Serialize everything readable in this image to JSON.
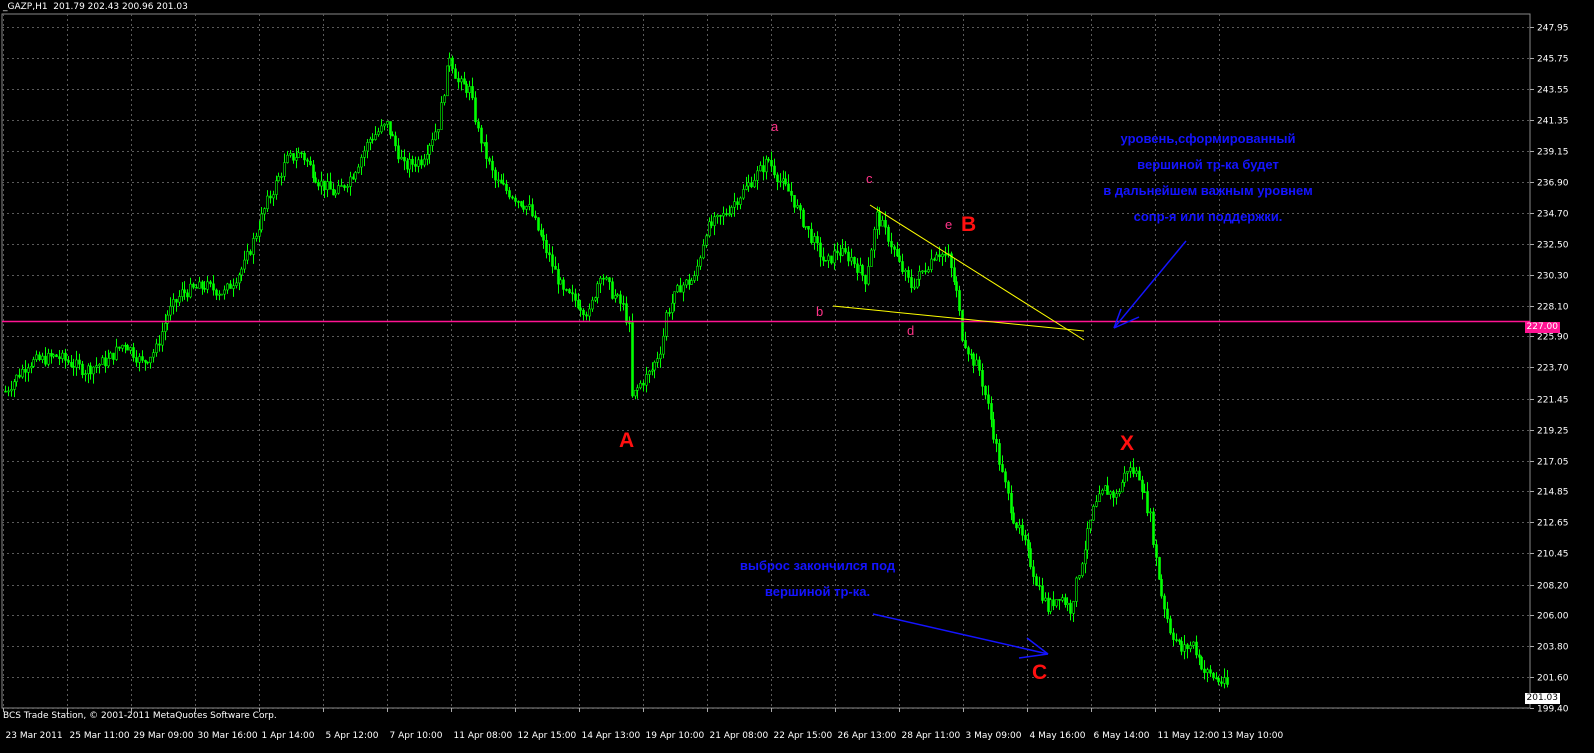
{
  "window": {
    "title": "_GAZP,H1  201.79 202.43 200.96 201.03",
    "footer": "BCS Trade Station, © 2001-2011 MetaQuotes Software Corp."
  },
  "colors": {
    "background": "#000000",
    "grid": "#5a5a5a",
    "candles": "#00ff00",
    "level_line": "#ff1493",
    "trend_lines": "#ffff00",
    "arrows": "#1414ff",
    "labels_small": "#ff3388",
    "labels_big": "#ff1010",
    "notes": "#1414ff"
  },
  "chart_data": {
    "type": "candlestick",
    "symbol": "_GAZP",
    "timeframe": "H1",
    "last_quote": {
      "open": 201.79,
      "high": 202.43,
      "low": 200.96,
      "close": 201.03
    },
    "y_ticks": [
      "247.95",
      "245.75",
      "243.55",
      "241.35",
      "239.15",
      "236.90",
      "234.70",
      "232.50",
      "230.30",
      "228.10",
      "225.90",
      "223.70",
      "221.45",
      "219.25",
      "217.05",
      "214.85",
      "212.65",
      "210.45",
      "208.20",
      "206.00",
      "203.80",
      "201.60",
      "199.40"
    ],
    "x_ticks": [
      "23 Mar 2011",
      "25 Mar 11:00",
      "29 Mar 09:00",
      "30 Mar 16:00",
      "1 Apr 14:00",
      "5 Apr 12:00",
      "7 Apr 10:00",
      "11 Apr 08:00",
      "12 Apr 15:00",
      "14 Apr 13:00",
      "19 Apr 10:00",
      "21 Apr 08:00",
      "22 Apr 15:00",
      "26 Apr 13:00",
      "28 Apr 11:00",
      "3 May 09:00",
      "4 May 16:00",
      "6 May 14:00",
      "11 May 12:00",
      "13 May 10:00"
    ],
    "ylim": [
      199.4,
      248.9
    ],
    "horizontal_level": {
      "price": 227.0,
      "label": "227.00"
    },
    "last_price_label": "201.03",
    "price_path": [
      [
        0,
        222.0
      ],
      [
        8,
        224.0
      ],
      [
        18,
        224.5
      ],
      [
        28,
        223.5
      ],
      [
        36,
        224.2
      ],
      [
        42,
        225.5
      ],
      [
        48,
        224.0
      ],
      [
        53,
        225.0
      ],
      [
        57,
        227.5
      ],
      [
        62,
        229.0
      ],
      [
        70,
        229.5
      ],
      [
        77,
        229.0
      ],
      [
        84,
        231.0
      ],
      [
        92,
        235.5
      ],
      [
        99,
        238.5
      ],
      [
        104,
        239.0
      ],
      [
        110,
        237.0
      ],
      [
        116,
        236.0
      ],
      [
        122,
        237.5
      ],
      [
        128,
        240.0
      ],
      [
        134,
        241.0
      ],
      [
        140,
        238.0
      ],
      [
        146,
        238.5
      ],
      [
        152,
        241.0
      ],
      [
        156,
        246.0
      ],
      [
        159,
        244.0
      ],
      [
        163,
        243.5
      ],
      [
        166,
        240.5
      ],
      [
        172,
        237.0
      ],
      [
        178,
        236.0
      ],
      [
        184,
        235.0
      ],
      [
        190,
        232.0
      ],
      [
        196,
        229.0
      ],
      [
        200,
        228.5
      ],
      [
        205,
        227.5
      ],
      [
        209,
        230.5
      ],
      [
        213,
        229.0
      ],
      [
        217,
        228.0
      ],
      [
        219,
        226.5
      ],
      [
        220,
        221.5
      ],
      [
        223,
        222.5
      ],
      [
        227,
        223.5
      ],
      [
        230,
        225.0
      ],
      [
        231,
        226.0
      ],
      [
        232,
        227.5
      ],
      [
        237,
        229.5
      ],
      [
        242,
        230.0
      ],
      [
        246,
        233.5
      ],
      [
        252,
        234.5
      ],
      [
        258,
        236.0
      ],
      [
        264,
        237.5
      ],
      [
        268,
        238.5
      ],
      [
        272,
        237.0
      ],
      [
        276,
        236.0
      ],
      [
        279,
        234.5
      ],
      [
        283,
        233.0
      ],
      [
        288,
        231.0
      ],
      [
        292,
        232.0
      ],
      [
        297,
        231.5
      ],
      [
        302,
        230.0
      ],
      [
        306,
        234.5
      ],
      [
        310,
        233.0
      ],
      [
        314,
        231.0
      ],
      [
        318,
        229.5
      ],
      [
        322,
        230.5
      ],
      [
        327,
        232.0
      ],
      [
        331,
        231.5
      ],
      [
        334,
        229.0
      ],
      [
        336,
        226.0
      ],
      [
        339,
        224.5
      ],
      [
        342,
        223.5
      ],
      [
        346,
        220.0
      ],
      [
        350,
        216.0
      ],
      [
        354,
        213.0
      ],
      [
        358,
        211.0
      ],
      [
        362,
        208.5
      ],
      [
        366,
        206.5
      ],
      [
        370,
        207.5
      ],
      [
        374,
        206.5
      ],
      [
        378,
        210.0
      ],
      [
        382,
        213.5
      ],
      [
        386,
        215.0
      ],
      [
        390,
        214.5
      ],
      [
        394,
        216.5
      ],
      [
        398,
        216.0
      ],
      [
        402,
        213.0
      ],
      [
        404,
        210.0
      ],
      [
        406,
        207.5
      ],
      [
        409,
        205.0
      ],
      [
        413,
        203.5
      ],
      [
        417,
        204.0
      ],
      [
        421,
        202.0
      ],
      [
        425,
        201.5
      ],
      [
        429,
        201.0
      ]
    ],
    "annotations": [
      {
        "id": "a",
        "text": "a",
        "kind": "wave-minor",
        "price": 240.2
      },
      {
        "id": "c",
        "text": "c",
        "kind": "wave-minor",
        "price": 236.0
      },
      {
        "id": "e",
        "text": "e",
        "kind": "wave-minor",
        "price": 233.8
      },
      {
        "id": "b",
        "text": "b",
        "kind": "wave-minor",
        "price": 228.0
      },
      {
        "id": "d",
        "text": "d",
        "kind": "wave-minor",
        "price": 227.0
      },
      {
        "id": "A",
        "text": "A",
        "kind": "wave-major",
        "price": 220.2
      },
      {
        "id": "B",
        "text": "B",
        "kind": "wave-major",
        "price": 233.8
      },
      {
        "id": "C",
        "text": "C",
        "kind": "wave-major",
        "price": 203.3
      },
      {
        "id": "X",
        "text": "X",
        "kind": "wave-major",
        "price": 219.3
      }
    ]
  },
  "notes": {
    "level_note": [
      "уровень,сформированный",
      "вершиной тр-ка будет",
      "в дальнейшем важным уровнем",
      "сопр-я или поддержки."
    ],
    "throw_note": [
      "выброс закончился под",
      "вершиной тр-ка."
    ]
  },
  "labels": {
    "a": "a",
    "c": "c",
    "e": "e",
    "b": "b",
    "d": "d",
    "A": "A",
    "B": "B",
    "C": "C",
    "X": "X"
  }
}
